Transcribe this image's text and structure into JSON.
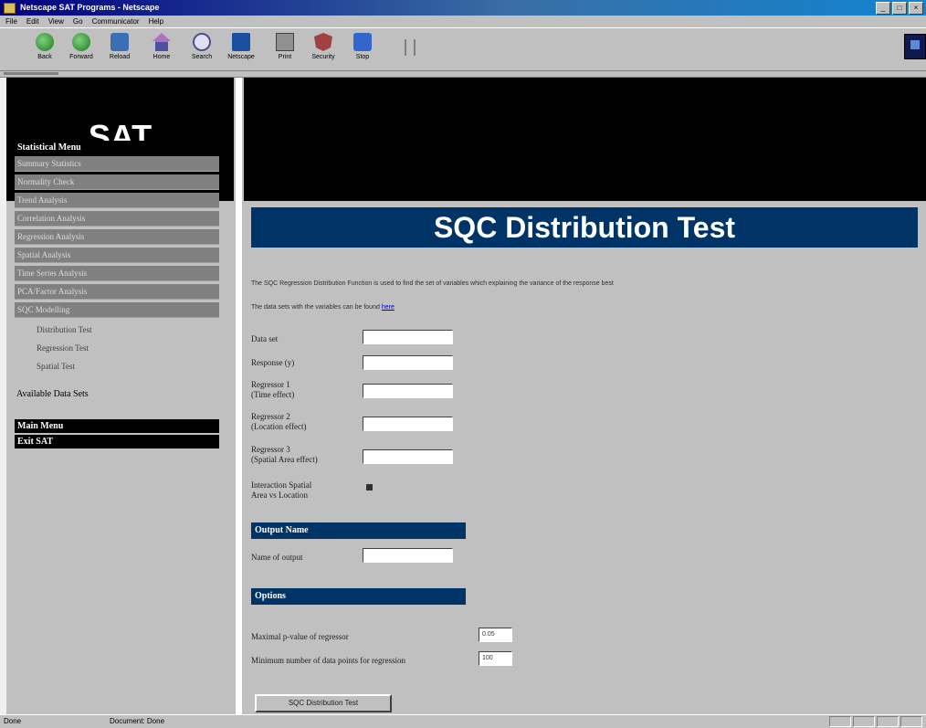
{
  "window": {
    "title": "Netscape SAT Programs - Netscape"
  },
  "menubar": {
    "items": [
      "File",
      "Edit",
      "View",
      "Go",
      "Communicator",
      "Help"
    ]
  },
  "toolbar": {
    "buttons": [
      {
        "label": "Back",
        "icon": "back-arrow-icon"
      },
      {
        "label": "Forward",
        "icon": "forward-arrow-icon"
      },
      {
        "label": "Reload",
        "icon": "reload-icon"
      },
      {
        "label": "Home",
        "icon": "home-icon"
      },
      {
        "label": "Search",
        "icon": "search-icon"
      },
      {
        "label": "Netscape",
        "icon": "netscape-icon"
      },
      {
        "label": "Print",
        "icon": "print-icon"
      },
      {
        "label": "Security",
        "icon": "security-icon"
      },
      {
        "label": "Stop",
        "icon": "stop-icon"
      }
    ]
  },
  "header": {
    "logo_text": "SAT"
  },
  "sidebar": {
    "menu_title": "Statistical Menu",
    "items": [
      "Summary Statistics",
      "Normality Check",
      "Trend Analysis",
      "Correlation Analysis",
      "Regression Analysis",
      "Spatial Analysis",
      "Time Series Analysis",
      "PCA/Factor Analysis",
      "SQC Modelling"
    ],
    "sub_items": [
      "Distribution Test",
      "Regression Test",
      "Spatial Test"
    ],
    "datasets_link": "Available Data Sets",
    "main_menu": "Main Menu",
    "exit": "Exit SAT"
  },
  "main": {
    "title": "SQC Distribution Test",
    "intro": "The SQC Regression Distribution Function is used to find the set of variables which explaining the variance of the response best",
    "data_sets_text": "The data sets with the variables can be found",
    "data_sets_link": "here",
    "fields": [
      {
        "label": "Data set",
        "value": ""
      },
      {
        "label": "Response (y)",
        "value": ""
      },
      {
        "label": "Regressor 1\n(Time effect)",
        "value": ""
      },
      {
        "label": "Regressor 2\n(Location effect)",
        "value": ""
      },
      {
        "label": "Regressor 3\n(Spatial Area effect)",
        "value": ""
      }
    ],
    "interaction_label": "Interaction Spatial\nArea vs Location",
    "interaction_checked": true,
    "output_section": "Output Name",
    "output_label": "Name of output",
    "options_section": "Options",
    "options": [
      {
        "label": "Maximal p-value of regressor",
        "value": "0.05"
      },
      {
        "label": "Minimum number of data points for regression",
        "value": "100"
      }
    ],
    "submit_label": "SQC Distribution Test"
  },
  "statusbar": {
    "left": "Done",
    "middle": "Document: Done"
  },
  "colors": {
    "banner_bg": "#003366",
    "header_bg": "#000000",
    "sidebar_item_bg": "#808080",
    "link": "#0000cc"
  }
}
